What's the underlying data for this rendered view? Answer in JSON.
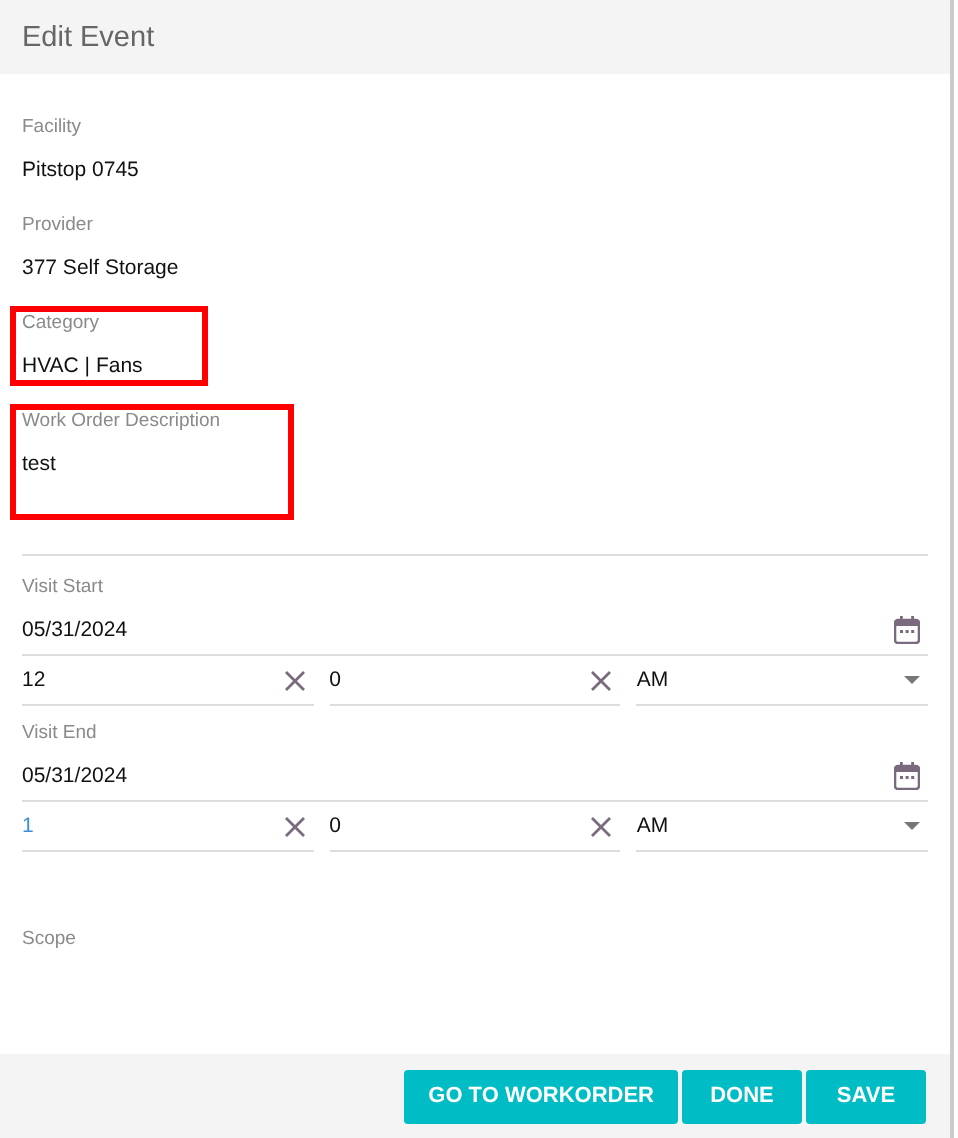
{
  "window": {
    "title": "Edit Event"
  },
  "info_fields": [
    {
      "label": "Facility",
      "value": "Pitstop 0745",
      "highlighted": false
    },
    {
      "label": "Provider",
      "value": "377 Self Storage",
      "highlighted": false
    },
    {
      "label": "Category",
      "value": "HVAC | Fans",
      "highlighted": true
    },
    {
      "label": "Work Order Description",
      "value": "test",
      "highlighted": true,
      "kind": "multiline"
    }
  ],
  "visits": [
    {
      "label": "Visit Start",
      "date": "05/31/2024",
      "hour": "12",
      "hour_focused": false,
      "minute": "0",
      "meridiem": "AM"
    },
    {
      "label": "Visit End",
      "date": "05/31/2024",
      "hour": "1",
      "hour_focused": true,
      "minute": "0",
      "meridiem": "AM"
    }
  ],
  "scope": {
    "label": "Scope"
  },
  "buttons": [
    "GO TO WORKORDER",
    "DONE",
    "SAVE"
  ]
}
